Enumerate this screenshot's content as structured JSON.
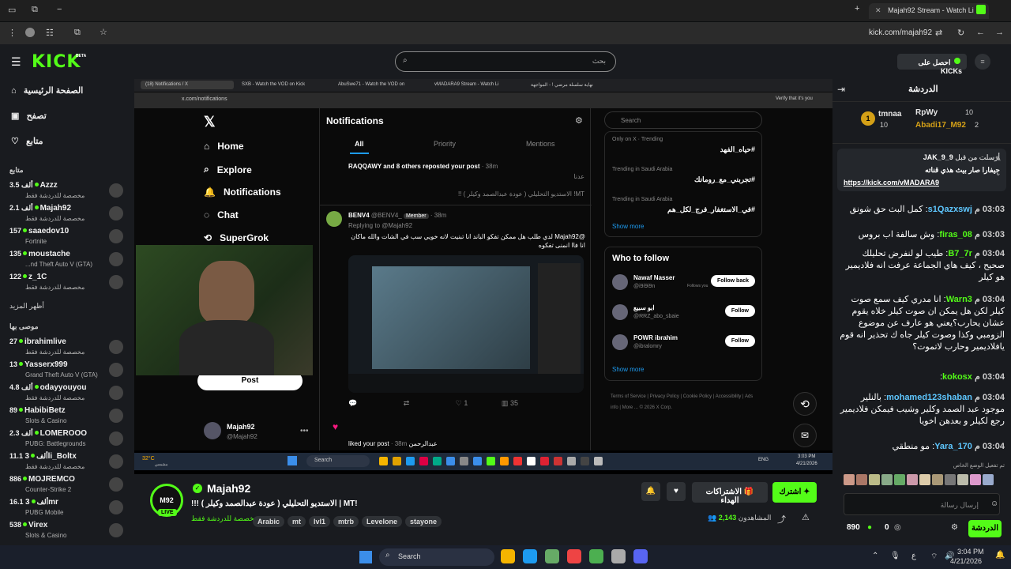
{
  "browser": {
    "tab_title": "Majah92 Stream - Watch Li",
    "address": "kick.com/majah92"
  },
  "header": {
    "logo": "KICK",
    "beta": "BETA",
    "search_placeholder": "بحث",
    "get_kicks": "احصل على KICKs"
  },
  "sidebar": {
    "nav": [
      "الصفحة الرئيسية",
      "تصفح",
      "متابع"
    ],
    "following_title": "متابع",
    "following": [
      {
        "name": "Azzz",
        "viewers": "3.5 ألف",
        "game": "مخصصة للدردشة فقط"
      },
      {
        "name": "Majah92",
        "viewers": "2.1 ألف",
        "game": "مخصصة للدردشة فقط"
      },
      {
        "name": "saaedov10",
        "viewers": "157",
        "game": "Fortnite"
      },
      {
        "name": "moustache",
        "viewers": "135",
        "game": "...nd Theft Auto V (GTA)"
      },
      {
        "name": "z_1C",
        "viewers": "122",
        "game": "مخصصة للدردشة فقط"
      }
    ],
    "show_more": "أظهر المزيد",
    "recommended_title": "موصى بها",
    "recommended": [
      {
        "name": "ibrahimlive",
        "viewers": "27",
        "game": "مخصصة للدردشة فقط"
      },
      {
        "name": "Yasserx999",
        "viewers": "13",
        "game": "Grand Theft Auto V (GTA)"
      },
      {
        "name": "odayyouyou",
        "viewers": "4.8 ألف",
        "game": "مخصصة للدردشة فقط"
      },
      {
        "name": "HabibiBetz",
        "viewers": "89",
        "game": "Slots & Casino"
      },
      {
        "name": "LOMEROOO",
        "viewers": "2.3 ألف",
        "game": "PUBG: Battlegrounds"
      },
      {
        "name": "3li_Boltx",
        "viewers": "11.1 ألف",
        "game": "مخصصة للدردشة فقط"
      },
      {
        "name": "MOJREMCO",
        "viewers": "886",
        "game": "Counter-Strike 2"
      },
      {
        "name": "3mr",
        "viewers": "16.1 ألف",
        "game": "PUBG Mobile"
      },
      {
        "name": "Virex",
        "viewers": "538",
        "game": "Slots & Casino"
      }
    ]
  },
  "stream": {
    "x": {
      "browser_tabs": [
        "(18) Notifications / X",
        "SXB - Watch the VOD on Kick",
        "AbuSwe71 - Watch the VOD on",
        "vMADARA9 Stream - Watch Li",
        "نهاية سلسلة مرضي ! - المواجهة"
      ],
      "address": "x.com/notifications",
      "nav": [
        "Home",
        "Explore",
        "Notifications",
        "Chat",
        "SuperGrok"
      ],
      "post_button": "Post",
      "profile_name": "Majah92",
      "profile_handle": "@Majah92",
      "notif_title": "Notifications",
      "notif_tabs": [
        "All",
        "Priority",
        "Mentions"
      ],
      "repost_text": "RAQQAWY and 8 others reposted your post",
      "repost_time": "· 38m",
      "repost_snippet": "عدنا",
      "repost_snippet2": "MT! الاستديو التحليلي ( عودة عبدالصمد وكيلر ) !!",
      "tweet_user": "BENV4",
      "tweet_handle": "@BENV4_",
      "tweet_badge": "Member",
      "tweet_time": "· 38m",
      "replying_to": "Replying to @Majah92",
      "tweet_text": "@Majah92 لدي طلب هل ممكن تفكو الباند انا تبنيت لانه خويي سب في الشات والله ماكان انا فاا انمنى تفكوه",
      "tweet_likes": "1",
      "tweet_views": "35",
      "liked_text": "عبدالرحمن liked your post",
      "liked_time": "· 38m",
      "search_placeholder": "Search",
      "trends": [
        {
          "meta": "Only on X · Trending",
          "tag": "#حياه_الفهد"
        },
        {
          "meta": "Trending in Saudi Arabia",
          "tag": "#تجربني_مع_رومانك"
        },
        {
          "meta": "Trending in Saudi Arabia",
          "tag": "#في_الاستغفار_فرج_لكل_هم"
        }
      ],
      "show_more": "Show more",
      "who_to_follow": "Who to follow",
      "suggestions": [
        {
          "name": "Nawaf Nasser",
          "handle": "@i9i9i9n",
          "extra": "Follows you",
          "btn": "Follow back"
        },
        {
          "name": "ابو سبيع",
          "handle": "@RRZ_abo_sbaie",
          "extra": "",
          "btn": "Follow"
        },
        {
          "name": "POWR ibrahim",
          "handle": "@ibralomry",
          "extra": "",
          "btn": "Follow"
        }
      ],
      "footer": "Terms of Service | Privacy Policy | Cookie Policy | Accessibility | Ads info | More ... © 2026 X Corp.",
      "verify": "Verify that it's you"
    },
    "inner_taskbar": {
      "weather": "32°C",
      "weather_sub": "مشمس",
      "search": "Search",
      "lang": "ENG",
      "time": "3:03 PM",
      "date": "4/21/2026"
    }
  },
  "channel": {
    "name": "Majah92",
    "live_badge": "LIVE",
    "title": "!MT | الاستديو التحليلي ( عودة عبدالصمد وكيلر ) !!!",
    "category": "مخصصة للدردشة فقط",
    "tags": [
      "Arabic",
      "mt",
      "lvl1",
      "mtrb",
      "Levelone",
      "stayone"
    ],
    "follow_btn": "اشترك",
    "gift_btn": "الاشتراكات الهداء",
    "viewers_label": "المشاهدون",
    "viewers": "2,143"
  },
  "chat": {
    "title": "الدردشة",
    "top": [
      {
        "name": "tmnaa",
        "score": "10",
        "rank": "1"
      },
      {
        "name": "RpWy",
        "score": "10"
      },
      {
        "name": "Abadi17_M92",
        "score": "2"
      }
    ],
    "pinned_user": "9_JAK_9",
    "pinned_label": "أرسلت من قبل",
    "pinned_text": "جيفارا صار بيث هذي قناته",
    "pinned_link": "https://kick.com/vMADARA9",
    "messages": [
      {
        "time": "03:03 م",
        "user": "s1Qazxswj",
        "color": "#5ec7ff",
        "text": "كمل البث  حق شونق"
      },
      {
        "time": "03:03 م",
        "user": "firas_08",
        "color": "#53fc18",
        "text": "وش سالفة اب بروس"
      },
      {
        "time": "03:04 م",
        "user": "B7_7r",
        "color": "#53fc18",
        "text": "طيب لو لنفرض تحليلك صحيح ، كيف هاي الجماعة عرفت انه فلاديمير هو كيلر"
      },
      {
        "time": "03:04 م",
        "user": "Warn3",
        "color": "#53fc18",
        "text": "انا مدري كيف سمع صوت كيلر لكن هل يمكن ان صوت كيلر خلاه يقوم عشان يحارب؟يعني هو عارف عن موضوع الزومبي وكذا وصوت كيلر جاه ك تحذير انه قوم يافلاديمير وحارب لاتموت؟"
      },
      {
        "time": "03:04 م",
        "user": "kokosx",
        "color": "#53fc18",
        "text": ""
      },
      {
        "time": "03:04 م",
        "user": "mohamed123shaban",
        "color": "#5ec7ff",
        "text": "بالنلير موجود عبد الصمد وكلير وشيب فيمكن فلاديمير رجع لكيلر و بعدهن اخويا"
      },
      {
        "time": "03:04 م",
        "user": "Yara_170",
        "color": "#5ec7ff",
        "text": "مو منطقي"
      }
    ],
    "unlocked_label": "تم تفعيل الوضع الخاص",
    "input_placeholder": "إرسال رسالة",
    "points": "890",
    "zero": "0",
    "chat_btn": "الدردشة"
  },
  "os_taskbar": {
    "search": "Search",
    "time": "3:04 PM",
    "date": "4/21/2026",
    "lang": "ع"
  }
}
